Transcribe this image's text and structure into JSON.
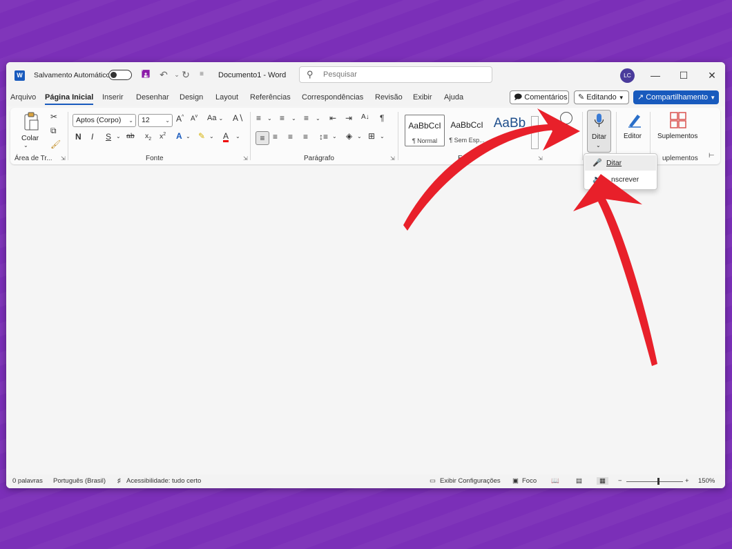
{
  "titlebar": {
    "app_icon": "W",
    "autosave_label": "Salvamento Automático",
    "document_title": "Documento1  -  Word",
    "search_placeholder": "Pesquisar",
    "avatar_initials": "LC"
  },
  "menu": {
    "tabs": [
      "Arquivo",
      "Página Inicial",
      "Inserir",
      "Desenhar",
      "Design",
      "Layout",
      "Referências",
      "Correspondências",
      "Revisão",
      "Exibir",
      "Ajuda"
    ],
    "active_tab": "Página Inicial",
    "comments_label": "Comentários",
    "editing_label": "Editando",
    "share_label": "Compartilhamento"
  },
  "ribbon": {
    "clipboard": {
      "paste_label": "Colar",
      "group_label": "Área de Tr..."
    },
    "font": {
      "font_name": "Aptos (Corpo)",
      "font_size": "12",
      "group_label": "Fonte",
      "change_case": "Aa"
    },
    "paragraph": {
      "group_label": "Parágrafo"
    },
    "styles": {
      "items": [
        {
          "preview": "AaBbCcI",
          "name": "¶ Normal"
        },
        {
          "preview": "AaBbCcI",
          "name": "¶ Sem Esp..."
        },
        {
          "preview": "AaBb",
          "name": ""
        }
      ],
      "group_label": "Est"
    },
    "voice": {
      "dictate_label": "Ditar"
    },
    "editor": {
      "label": "Editor"
    },
    "addins": {
      "label": "Suplementos",
      "group_label": "uplementos"
    }
  },
  "dictate_menu": {
    "items": [
      {
        "label": "Ditar",
        "icon": "mic-icon"
      },
      {
        "label": "nscrever",
        "icon": "transcribe-icon"
      }
    ]
  },
  "statusbar": {
    "word_count": "0 palavras",
    "language": "Português (Brasil)",
    "accessibility": "Acessibilidade: tudo certo",
    "display_settings": "Exibir Configurações",
    "focus": "Foco",
    "zoom_minus": "−",
    "zoom_plus": "+",
    "zoom_level": "150%"
  },
  "colors": {
    "background": "#7b2fb8",
    "accent": "#185abd",
    "arrow": "#e8202a"
  }
}
